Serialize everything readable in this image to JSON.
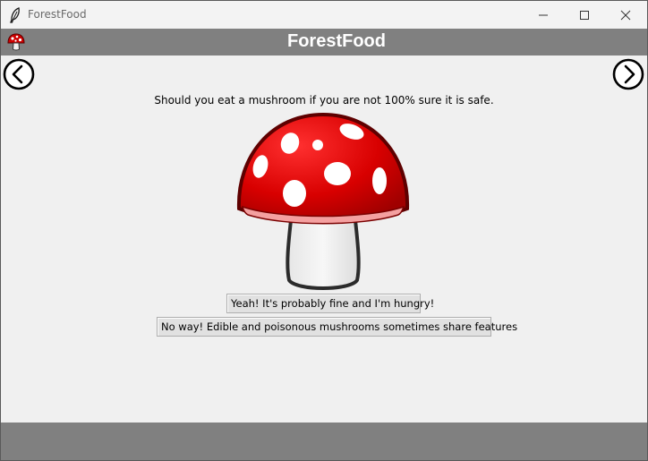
{
  "window": {
    "title": "ForestFood",
    "app_icon": "feather-icon",
    "controls": [
      "minimize-icon",
      "maximize-icon",
      "close-icon"
    ]
  },
  "header": {
    "title": "ForestFood",
    "icon": "mushroom-icon"
  },
  "navigation": {
    "prev_icon": "left-arrow-circle-icon",
    "next_icon": "right-arrow-circle-icon"
  },
  "quiz": {
    "question": "Should you eat a mushroom if you are not 100% sure it is safe.",
    "image": "red-toadstool-mushroom",
    "answers": [
      "Yeah! It's probably fine and I'm hungry!",
      "No way! Edible and poisonous mushrooms sometimes share features"
    ]
  },
  "colors": {
    "bar_gray": "#808080",
    "background": "#f0f0f0",
    "mushroom_cap": "#d40000",
    "mushroom_spots": "#ffffff"
  }
}
